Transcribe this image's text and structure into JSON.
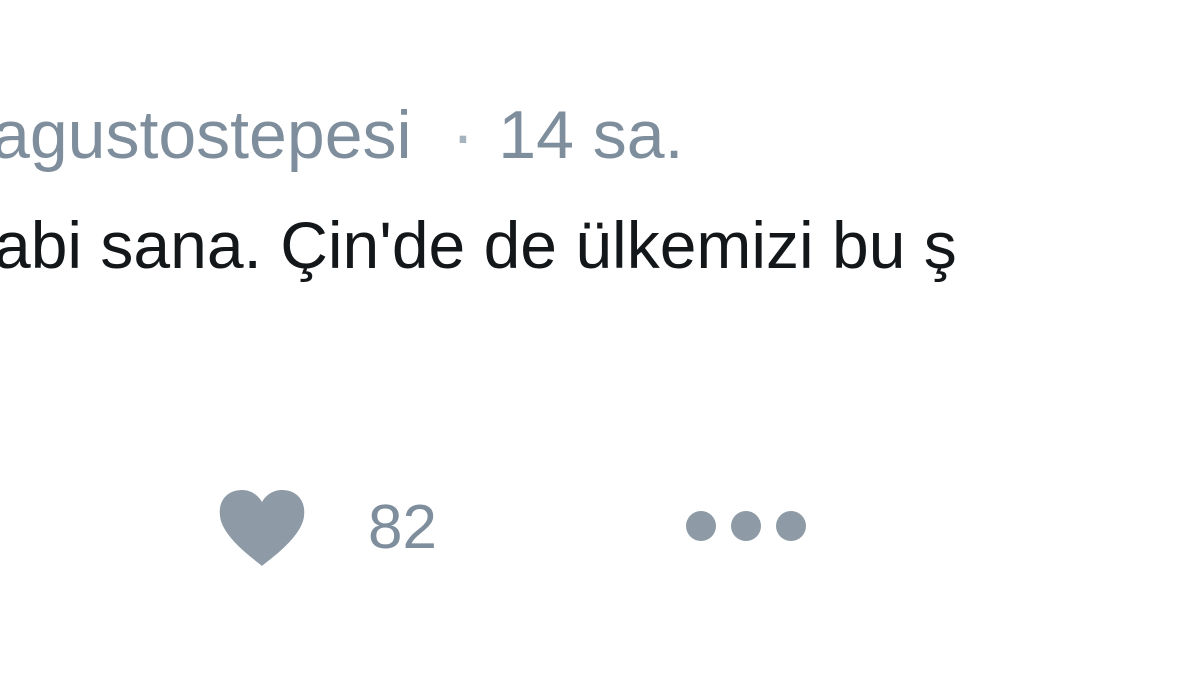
{
  "tweet": {
    "username": "agustostepesi",
    "separator": "·",
    "timestamp": "14 sa.",
    "text": "abi sana. Çin'de de ülkemizi bu ş"
  },
  "actions": {
    "like_icon": "heart-icon",
    "like_count": "82",
    "more_icon": "more-dots-icon"
  },
  "colors": {
    "meta_text": "#7e8e9c",
    "body_text": "#14171a",
    "icon": "#8e9ba6",
    "background": "#ffffff"
  }
}
